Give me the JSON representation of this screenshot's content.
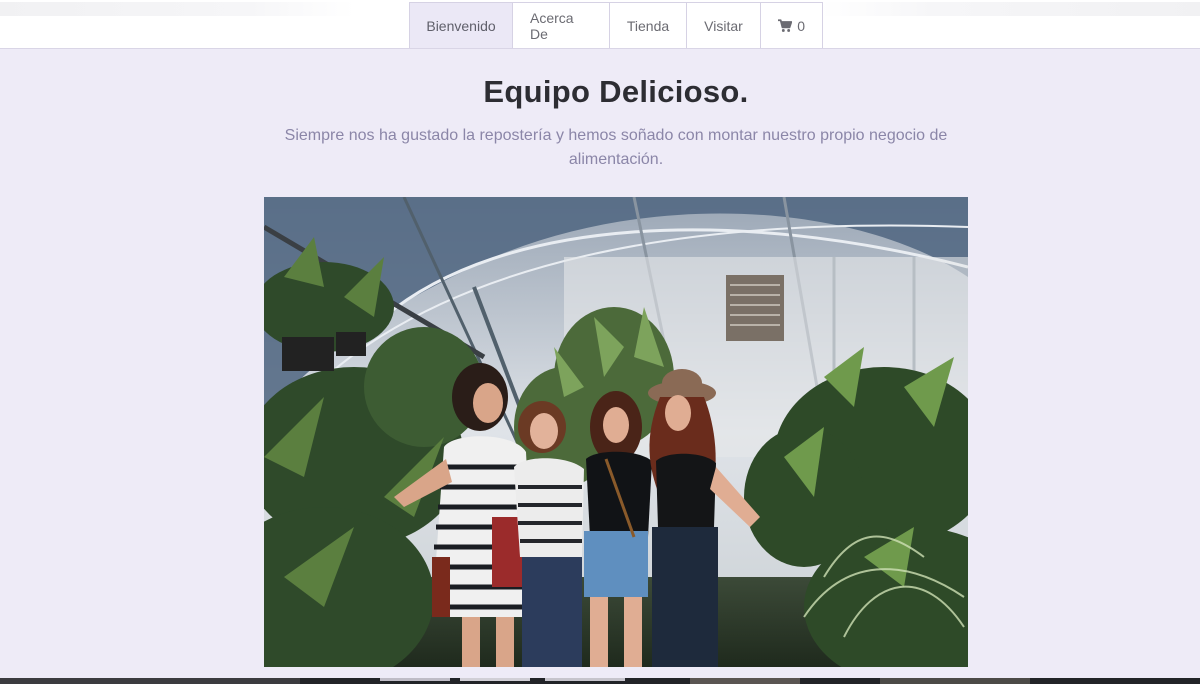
{
  "nav": {
    "items": [
      {
        "label": "Bienvenido",
        "active": true
      },
      {
        "label": "Acerca De",
        "active": false
      },
      {
        "label": "Tienda",
        "active": false
      },
      {
        "label": "Visitar",
        "active": false
      }
    ],
    "cart": {
      "icon": "shopping-cart-icon",
      "count": "0"
    }
  },
  "hero": {
    "title": "Equipo Delicioso.",
    "subtitle": "Siempre nos ha gustado la repostería y hemos soñado con montar nuestro propio negocio de alimentación."
  },
  "colors": {
    "page_background": "#eeebf7",
    "active_tab": "#ebe8f6",
    "subtitle_text": "#8b86a8",
    "title_text": "#2d2d33"
  }
}
